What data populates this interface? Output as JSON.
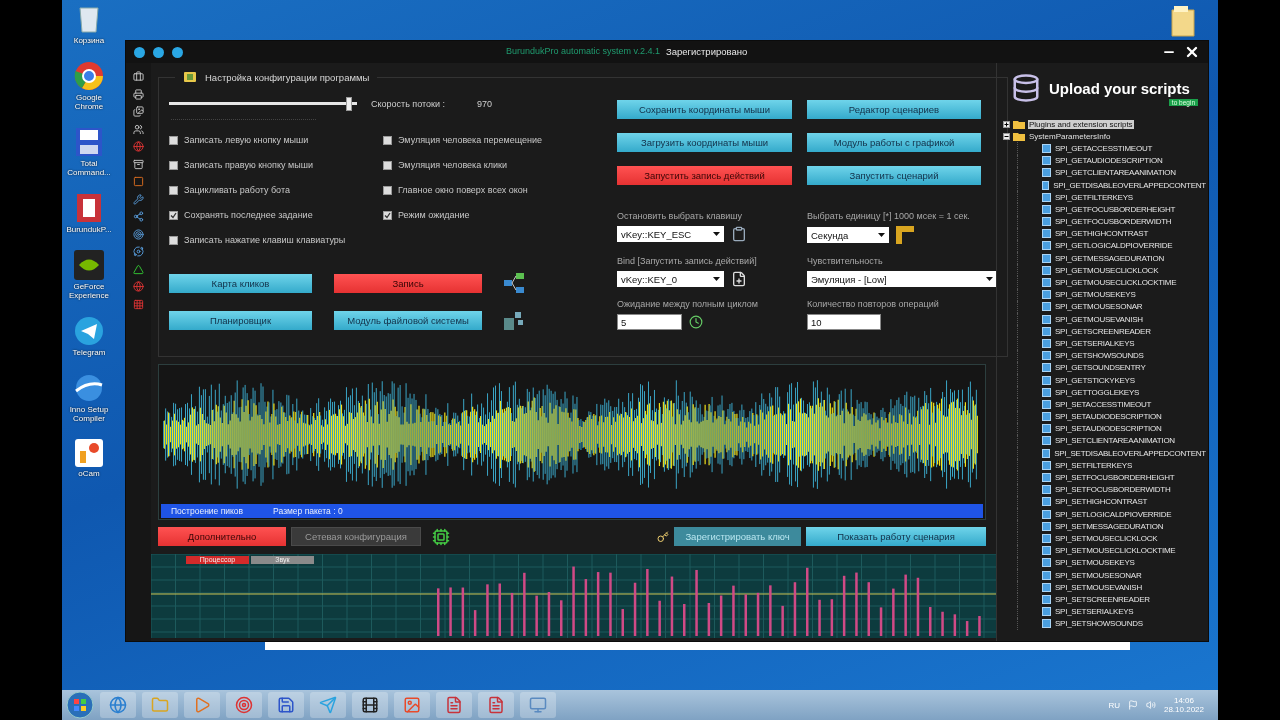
{
  "desktop_icons": [
    {
      "label": "Корзина",
      "kind": "bin"
    },
    {
      "label": "Google Chrome",
      "kind": "browser"
    },
    {
      "label": "Total Command...",
      "kind": "disk"
    },
    {
      "label": "BurundukP...",
      "kind": "document"
    },
    {
      "label": "GeForce Experience",
      "kind": "chip"
    },
    {
      "label": "Telegram",
      "kind": "messenger"
    },
    {
      "label": "Inno Setup Compiler",
      "kind": "globe"
    },
    {
      "label": "oCam",
      "kind": "camera"
    }
  ],
  "window": {
    "title": "BurundukPro automatic system v.2.4.1",
    "status": "Зарегистрировано"
  },
  "config": {
    "title": "Настройка конфигурации программы",
    "speed": {
      "label": "Скорость потоки :",
      "value": "970",
      "level": 0.96
    },
    "left_checkboxes": [
      {
        "label": "Записать левую кнопку мыши",
        "checked": false
      },
      {
        "label": "Записать правую кнопку мыши",
        "checked": false
      },
      {
        "label": "Зацикливать работу бота",
        "checked": false
      },
      {
        "label": "Сохранять последнее задание",
        "checked": true
      },
      {
        "label": "Записать нажатие клавиш клавиатуры",
        "checked": false
      }
    ],
    "right_checkboxes": [
      {
        "label": "Эмуляция человека перемещение",
        "checked": false
      },
      {
        "label": "Эмуляция человека клики",
        "checked": false
      },
      {
        "label": "Главное окно поверх всех окон",
        "checked": false
      },
      {
        "label": "Режим ожидание",
        "checked": true
      }
    ],
    "left_buttons": [
      {
        "label": "Карта кликов",
        "kind": "primary"
      },
      {
        "label": "Запись",
        "kind": "danger"
      },
      {
        "label": "Планировщик",
        "kind": "primary"
      },
      {
        "label": "Модуль файловой системы",
        "kind": "primary"
      }
    ],
    "right_buttons": [
      {
        "label": "Сохранить координаты мыши",
        "kind": "primary"
      },
      {
        "label": "Редактор сценариев",
        "kind": "primary"
      },
      {
        "label": "Загрузить координаты мыши",
        "kind": "primary"
      },
      {
        "label": "Модуль работы с графикой",
        "kind": "primary"
      },
      {
        "label": "Запустить запись действий",
        "kind": "danger"
      },
      {
        "label": "Запустить сценарий",
        "kind": "primary"
      }
    ],
    "fields": [
      {
        "label": "Остановить выбрать клавишу",
        "kind": "select",
        "value": "vKey::KEY_ESC"
      },
      {
        "label": "Выбрать единицу [*] 1000 мсек = 1 сек.",
        "kind": "select",
        "value": "Секунда"
      },
      {
        "label": "Bind [Запустить запись действий]",
        "kind": "select",
        "value": "vKey::KEY_0"
      },
      {
        "label": "Чувствительность",
        "kind": "select",
        "value": "Эмуляция - [Low]"
      },
      {
        "label": "Ожидание между полным циклом",
        "kind": "input",
        "value": "5"
      },
      {
        "label": "Количество повторов операций",
        "kind": "input",
        "value": "10"
      }
    ]
  },
  "status_bar": {
    "left": "Построение пиков",
    "right": "Размер пакета : 0"
  },
  "bottom_buttons": [
    {
      "label": "Дополнительно",
      "kind": "danger",
      "disabled": false
    },
    {
      "label": "Сетевая конфигурация",
      "kind": "secondary",
      "disabled": false
    },
    {
      "label": "Зарегистрировать ключ",
      "kind": "primary",
      "disabled": true
    },
    {
      "label": "Показать работу сценария",
      "kind": "primary",
      "disabled": false
    }
  ],
  "chart_legend": [
    {
      "label": "Процессор",
      "color": "#d42a2a"
    },
    {
      "label": "Звук",
      "color": "#8a8a8a"
    }
  ],
  "scripts_panel": {
    "title": "Upload your scripts",
    "badge": "to begin",
    "tree": [
      {
        "label": "Plugins and extension scripts",
        "expanded": false,
        "selected": true
      },
      {
        "label": "SystemParametersInfo",
        "expanded": true,
        "selected": false,
        "children": [
          "SPI_GETACCESSTIMEOUT",
          "SPI_GETAUDIODESCRIPTION",
          "SPI_GETCLIENTAREAANIMATION",
          "SPI_GETDISABLEOVERLAPPEDCONTENT",
          "SPI_GETFILTERKEYS",
          "SPI_GETFOCUSBORDERHEIGHT",
          "SPI_GETFOCUSBORDERWIDTH",
          "SPI_GETHIGHCONTRAST",
          "SPI_GETLOGICALDPIOVERRIDE",
          "SPI_GETMESSAGEDURATION",
          "SPI_GETMOUSECLICKLOCK",
          "SPI_GETMOUSECLICKLOCKTIME",
          "SPI_GETMOUSEKEYS",
          "SPI_GETMOUSESONAR",
          "SPI_GETMOUSEVANISH",
          "SPI_GETSCREENREADER",
          "SPI_GETSERIALKEYS",
          "SPI_GETSHOWSOUNDS",
          "SPI_GETSOUNDSENTRY",
          "SPI_GETSTICKYKEYS",
          "SPI_GETTOGGLEKEYS",
          "SPI_SETACCESSTIMEOUT",
          "SPI_SETAUDIODESCRIPTION",
          "SPI_SETAUDIODESCRIPTION",
          "SPI_SETCLIENTAREAANIMATION",
          "SPI_SETDISABLEOVERLAPPEDCONTENT",
          "SPI_SETFILTERKEYS",
          "SPI_SETFOCUSBORDERHEIGHT",
          "SPI_SETFOCUSBORDERWIDTH",
          "SPI_SETHIGHCONTRAST",
          "SPI_SETLOGICALDPIOVERRIDE",
          "SPI_SETMESSAGEDURATION",
          "SPI_SETMOUSECLICKLOCK",
          "SPI_SETMOUSECLICKLOCKTIME",
          "SPI_SETMOUSEKEYS",
          "SPI_SETMOUSESONAR",
          "SPI_SETMOUSEVANISH",
          "SPI_SETSCREENREADER",
          "SPI_SETSERIALKEYS",
          "SPI_SETSHOWSOUNDS"
        ]
      }
    ]
  },
  "taskbar": {
    "language": "RU",
    "time": "14:06",
    "date": "28.10.2022"
  }
}
